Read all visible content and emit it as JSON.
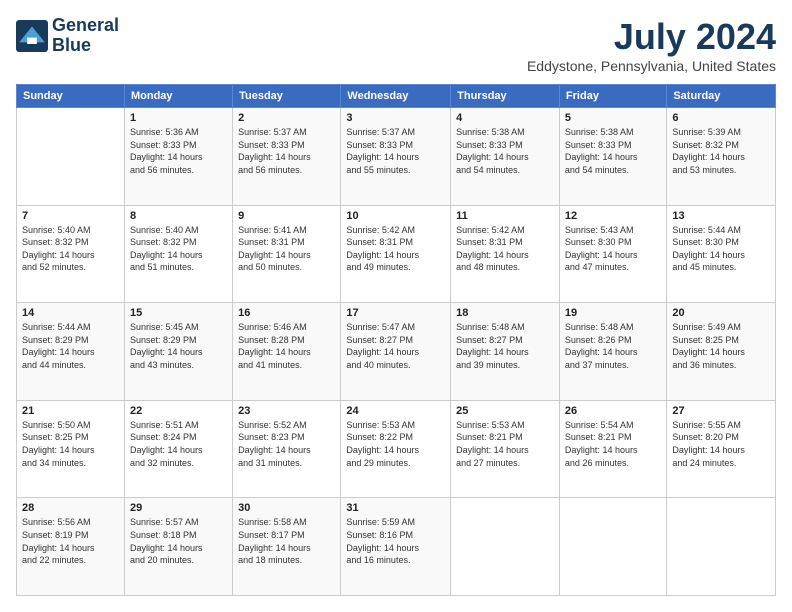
{
  "logo": {
    "line1": "General",
    "line2": "Blue"
  },
  "title": "July 2024",
  "subtitle": "Eddystone, Pennsylvania, United States",
  "days": [
    "Sunday",
    "Monday",
    "Tuesday",
    "Wednesday",
    "Thursday",
    "Friday",
    "Saturday"
  ],
  "weeks": [
    [
      {
        "date": "",
        "info": ""
      },
      {
        "date": "1",
        "info": "Sunrise: 5:36 AM\nSunset: 8:33 PM\nDaylight: 14 hours\nand 56 minutes."
      },
      {
        "date": "2",
        "info": "Sunrise: 5:37 AM\nSunset: 8:33 PM\nDaylight: 14 hours\nand 56 minutes."
      },
      {
        "date": "3",
        "info": "Sunrise: 5:37 AM\nSunset: 8:33 PM\nDaylight: 14 hours\nand 55 minutes."
      },
      {
        "date": "4",
        "info": "Sunrise: 5:38 AM\nSunset: 8:33 PM\nDaylight: 14 hours\nand 54 minutes."
      },
      {
        "date": "5",
        "info": "Sunrise: 5:38 AM\nSunset: 8:33 PM\nDaylight: 14 hours\nand 54 minutes."
      },
      {
        "date": "6",
        "info": "Sunrise: 5:39 AM\nSunset: 8:32 PM\nDaylight: 14 hours\nand 53 minutes."
      }
    ],
    [
      {
        "date": "7",
        "info": "Sunrise: 5:40 AM\nSunset: 8:32 PM\nDaylight: 14 hours\nand 52 minutes."
      },
      {
        "date": "8",
        "info": "Sunrise: 5:40 AM\nSunset: 8:32 PM\nDaylight: 14 hours\nand 51 minutes."
      },
      {
        "date": "9",
        "info": "Sunrise: 5:41 AM\nSunset: 8:31 PM\nDaylight: 14 hours\nand 50 minutes."
      },
      {
        "date": "10",
        "info": "Sunrise: 5:42 AM\nSunset: 8:31 PM\nDaylight: 14 hours\nand 49 minutes."
      },
      {
        "date": "11",
        "info": "Sunrise: 5:42 AM\nSunset: 8:31 PM\nDaylight: 14 hours\nand 48 minutes."
      },
      {
        "date": "12",
        "info": "Sunrise: 5:43 AM\nSunset: 8:30 PM\nDaylight: 14 hours\nand 47 minutes."
      },
      {
        "date": "13",
        "info": "Sunrise: 5:44 AM\nSunset: 8:30 PM\nDaylight: 14 hours\nand 45 minutes."
      }
    ],
    [
      {
        "date": "14",
        "info": "Sunrise: 5:44 AM\nSunset: 8:29 PM\nDaylight: 14 hours\nand 44 minutes."
      },
      {
        "date": "15",
        "info": "Sunrise: 5:45 AM\nSunset: 8:29 PM\nDaylight: 14 hours\nand 43 minutes."
      },
      {
        "date": "16",
        "info": "Sunrise: 5:46 AM\nSunset: 8:28 PM\nDaylight: 14 hours\nand 41 minutes."
      },
      {
        "date": "17",
        "info": "Sunrise: 5:47 AM\nSunset: 8:27 PM\nDaylight: 14 hours\nand 40 minutes."
      },
      {
        "date": "18",
        "info": "Sunrise: 5:48 AM\nSunset: 8:27 PM\nDaylight: 14 hours\nand 39 minutes."
      },
      {
        "date": "19",
        "info": "Sunrise: 5:48 AM\nSunset: 8:26 PM\nDaylight: 14 hours\nand 37 minutes."
      },
      {
        "date": "20",
        "info": "Sunrise: 5:49 AM\nSunset: 8:25 PM\nDaylight: 14 hours\nand 36 minutes."
      }
    ],
    [
      {
        "date": "21",
        "info": "Sunrise: 5:50 AM\nSunset: 8:25 PM\nDaylight: 14 hours\nand 34 minutes."
      },
      {
        "date": "22",
        "info": "Sunrise: 5:51 AM\nSunset: 8:24 PM\nDaylight: 14 hours\nand 32 minutes."
      },
      {
        "date": "23",
        "info": "Sunrise: 5:52 AM\nSunset: 8:23 PM\nDaylight: 14 hours\nand 31 minutes."
      },
      {
        "date": "24",
        "info": "Sunrise: 5:53 AM\nSunset: 8:22 PM\nDaylight: 14 hours\nand 29 minutes."
      },
      {
        "date": "25",
        "info": "Sunrise: 5:53 AM\nSunset: 8:21 PM\nDaylight: 14 hours\nand 27 minutes."
      },
      {
        "date": "26",
        "info": "Sunrise: 5:54 AM\nSunset: 8:21 PM\nDaylight: 14 hours\nand 26 minutes."
      },
      {
        "date": "27",
        "info": "Sunrise: 5:55 AM\nSunset: 8:20 PM\nDaylight: 14 hours\nand 24 minutes."
      }
    ],
    [
      {
        "date": "28",
        "info": "Sunrise: 5:56 AM\nSunset: 8:19 PM\nDaylight: 14 hours\nand 22 minutes."
      },
      {
        "date": "29",
        "info": "Sunrise: 5:57 AM\nSunset: 8:18 PM\nDaylight: 14 hours\nand 20 minutes."
      },
      {
        "date": "30",
        "info": "Sunrise: 5:58 AM\nSunset: 8:17 PM\nDaylight: 14 hours\nand 18 minutes."
      },
      {
        "date": "31",
        "info": "Sunrise: 5:59 AM\nSunset: 8:16 PM\nDaylight: 14 hours\nand 16 minutes."
      },
      {
        "date": "",
        "info": ""
      },
      {
        "date": "",
        "info": ""
      },
      {
        "date": "",
        "info": ""
      }
    ]
  ]
}
